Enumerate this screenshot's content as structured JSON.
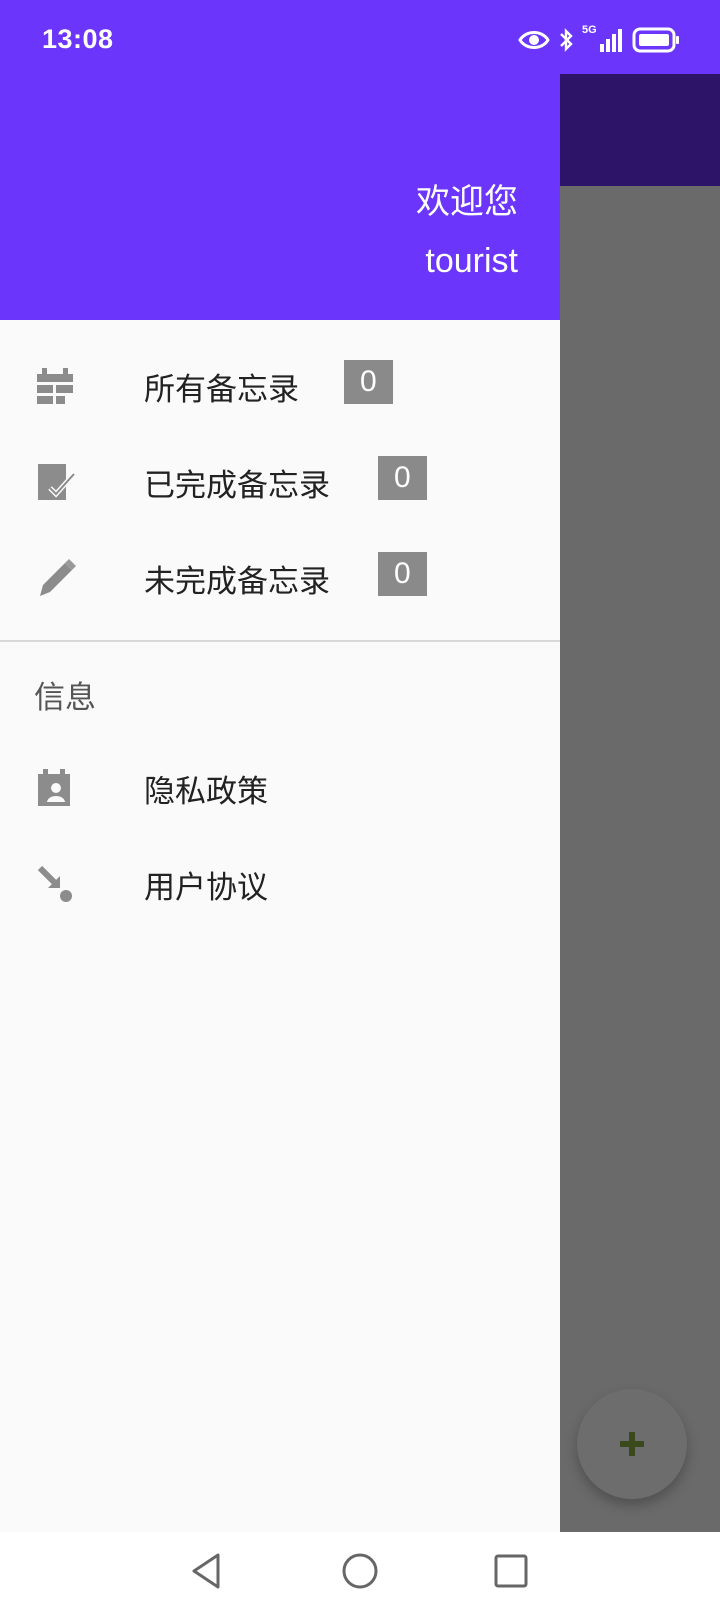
{
  "status_bar": {
    "time": "13:08",
    "network": "5G",
    "icons": [
      "eye-icon",
      "bluetooth-icon",
      "signal-icon",
      "battery-icon"
    ]
  },
  "drawer": {
    "greeting": "欢迎您",
    "username": "tourist",
    "items": [
      {
        "label": "所有备忘录",
        "count": "0",
        "icon": "calendar-grid-icon"
      },
      {
        "label": "已完成备忘录",
        "count": "0",
        "icon": "checked-note-icon"
      },
      {
        "label": "未完成备忘录",
        "count": "0",
        "icon": "pencil-icon"
      }
    ],
    "section_title": "信息",
    "info_items": [
      {
        "label": "隐私政策",
        "icon": "calendar-person-icon"
      },
      {
        "label": "用户协议",
        "icon": "arrow-dot-icon"
      }
    ]
  },
  "fab": {
    "icon": "plus-icon"
  },
  "colors": {
    "primary": "#6b35fb",
    "toolbar_dimmed": "#2d1468",
    "badge": "#8a8a8a",
    "fab_plus": "#3b4a1c"
  },
  "nav_bar": {
    "buttons": [
      "back-icon",
      "home-icon",
      "recents-icon"
    ]
  }
}
